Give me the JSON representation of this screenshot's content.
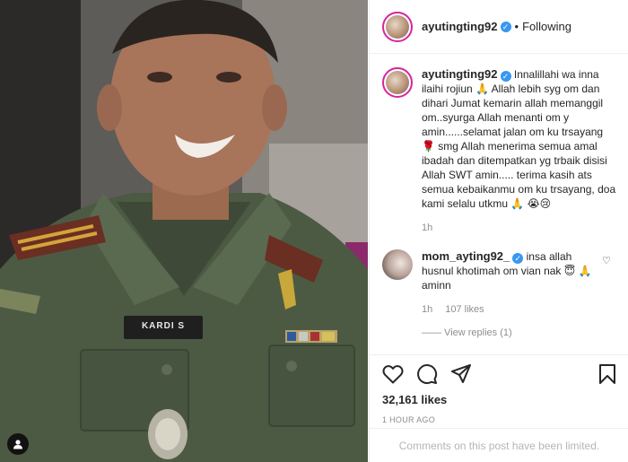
{
  "post": {
    "username": "ayutingting92",
    "following_label": "Following",
    "dot": "•",
    "caption_text": "Innalillahi wa inna ilaihi rojiun 🙏 Allah lebih syg om dan dihari Jumat kemarin allah memanggil om..syurga Allah menanti om y amin......selamat jalan om ku trsayang 🌹 smg Allah menerima semua amal ibadah dan ditempatkan yg trbaik disisi Allah SWT amin..... terima kasih ats semua kebaikanmu om ku trsayang, doa kami selalu utkmu 🙏 😭😢",
    "caption_time": "1h",
    "name_tag": "KARDI S"
  },
  "comment": {
    "username": "mom_ayting92_",
    "text": "insa allah husnul khotimah om vian nak 😇 🙏 aminn",
    "time": "1h",
    "likes": "107 likes",
    "view_replies": "—— View replies (1)"
  },
  "stats": {
    "likes": "32,161 likes",
    "time_ago": "1 HOUR AGO",
    "comments_limited": "Comments on this post have been limited."
  },
  "icons": {
    "like": "heart-icon",
    "comment": "comment-icon",
    "share": "share-icon",
    "save": "bookmark-icon",
    "tag": "user-tag-icon",
    "verified": "verified-badge-icon"
  },
  "colors": {
    "verified": "#3897f0",
    "muted": "#8e8e8e",
    "text": "#262626"
  }
}
